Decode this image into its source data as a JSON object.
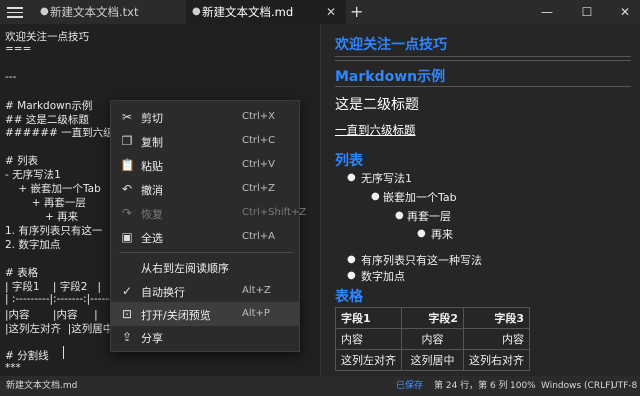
{
  "tabs": [
    {
      "label": "新建文本文档.txt",
      "active": false
    },
    {
      "label": "新建文本文档.md",
      "active": true
    }
  ],
  "window": {
    "minimize": "—",
    "maximize": "☐",
    "close": "✕",
    "add_tab": "+"
  },
  "editor": {
    "lines": [
      "欢迎关注一点技巧",
      "===",
      "",
      "---",
      "",
      "# Markdown示例",
      "## 这是二级标题",
      "###### 一直到六级标",
      "",
      "# 列表",
      "- 无序写法1",
      "    + 嵌套加一个Tab",
      "        + 再套一层",
      "            + 再来",
      "1. 有序列表只有这一",
      "2. 数字加点",
      "",
      "# 表格",
      "| 字段1    | 字段2   |",
      "| :---------|:-------:|------",
      "|内容       |内容     |",
      "|这列左对齐  |这列居中",
      "",
      "# 分割线",
      "***"
    ]
  },
  "context_menu": {
    "items": [
      {
        "icon": "scissors-icon",
        "glyph": "✂",
        "label": "剪切",
        "shortcut": "Ctrl+X",
        "disabled": false
      },
      {
        "icon": "copy-icon",
        "glyph": "❐",
        "label": "复制",
        "shortcut": "Ctrl+C",
        "disabled": false
      },
      {
        "icon": "paste-icon",
        "glyph": "📋",
        "label": "粘贴",
        "shortcut": "Ctrl+V",
        "disabled": false
      },
      {
        "icon": "undo-icon",
        "glyph": "↶",
        "label": "撤消",
        "shortcut": "Ctrl+Z",
        "disabled": false
      },
      {
        "icon": "redo-icon",
        "glyph": "↷",
        "label": "恢复",
        "shortcut": "Ctrl+Shift+Z",
        "disabled": true
      },
      {
        "icon": "select-all-icon",
        "glyph": "▣",
        "label": "全选",
        "shortcut": "Ctrl+A",
        "disabled": false
      },
      {
        "icon": "",
        "glyph": "",
        "label": "从右到左阅读顺序",
        "shortcut": "",
        "disabled": false
      },
      {
        "icon": "checkmark-icon",
        "glyph": "✓",
        "label": "自动换行",
        "shortcut": "Alt+Z",
        "disabled": false
      },
      {
        "icon": "preview-icon",
        "glyph": "⊡",
        "label": "打开/关闭预览",
        "shortcut": "Alt+P",
        "disabled": false
      },
      {
        "icon": "share-icon",
        "glyph": "⇪",
        "label": "分享",
        "shortcut": "",
        "disabled": false
      }
    ]
  },
  "preview": {
    "h1": "欢迎关注一点技巧",
    "h1b": "Markdown示例",
    "h2": "这是二级标题",
    "h6": "一直到六级标题",
    "h_list": "列表",
    "l1": "无序写法1",
    "l2": "嵌套加一个Tab",
    "l3": "再套一层",
    "l4": "再来",
    "o1": "有序列表只有这一种写法",
    "o2": "数字加点",
    "h_table": "表格",
    "table": {
      "headers": [
        "字段1",
        "字段2",
        "字段3"
      ],
      "rows": [
        [
          "内容",
          "内容",
          "内容"
        ],
        [
          "这列左对齐",
          "这列居中",
          "这列右对齐"
        ]
      ]
    }
  },
  "status": {
    "filename": "新建文本文档.md",
    "saved": "已保存",
    "position": "第 24 行，第 6 列",
    "zoom": "100%",
    "line_ending": "Windows (CRLF)",
    "encoding": "UTF-8"
  }
}
